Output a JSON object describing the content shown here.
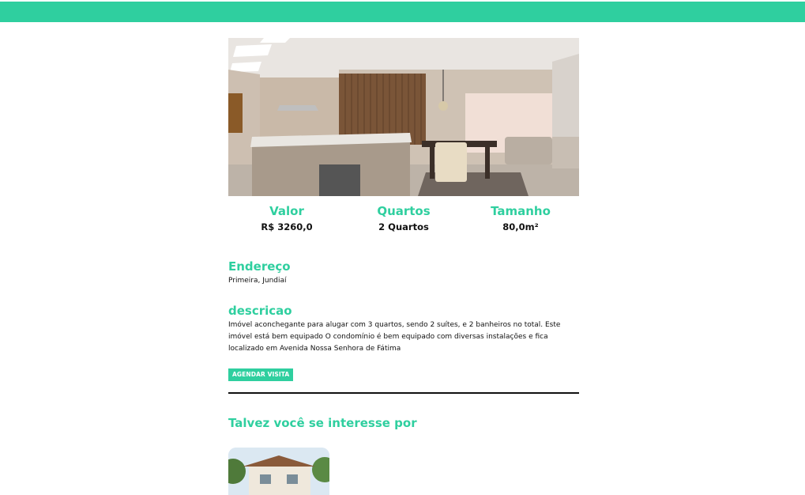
{
  "header": {
    "color": "#2fcf9f"
  },
  "listing": {
    "image": "apartment-interior-photo",
    "stats": [
      {
        "label": "Valor",
        "value": "R$ 3260,0"
      },
      {
        "label": "Quartos",
        "value": "2 Quartos"
      },
      {
        "label": "Tamanho",
        "value": "80,0m²"
      }
    ],
    "address": {
      "title": "Endereço",
      "text": "Primeira, Jundiaí"
    },
    "description": {
      "title": "descricao",
      "text": "Imóvel aconchegante para alugar com 3 quartos, sendo 2 suítes, e 2 banheiros no total. Este imóvel está bem equipado O condomínio é bem equipado com diversas instalações e fica localizado em Avenida Nossa Senhora de Fátima"
    },
    "schedule_button": "AGENDAR VISITA"
  },
  "suggestions": {
    "title": "Talvez você se interesse por",
    "items": [
      {
        "image": "house-exterior-photo"
      }
    ]
  },
  "colors": {
    "accent": "#2fcf9f",
    "text": "#111111"
  }
}
